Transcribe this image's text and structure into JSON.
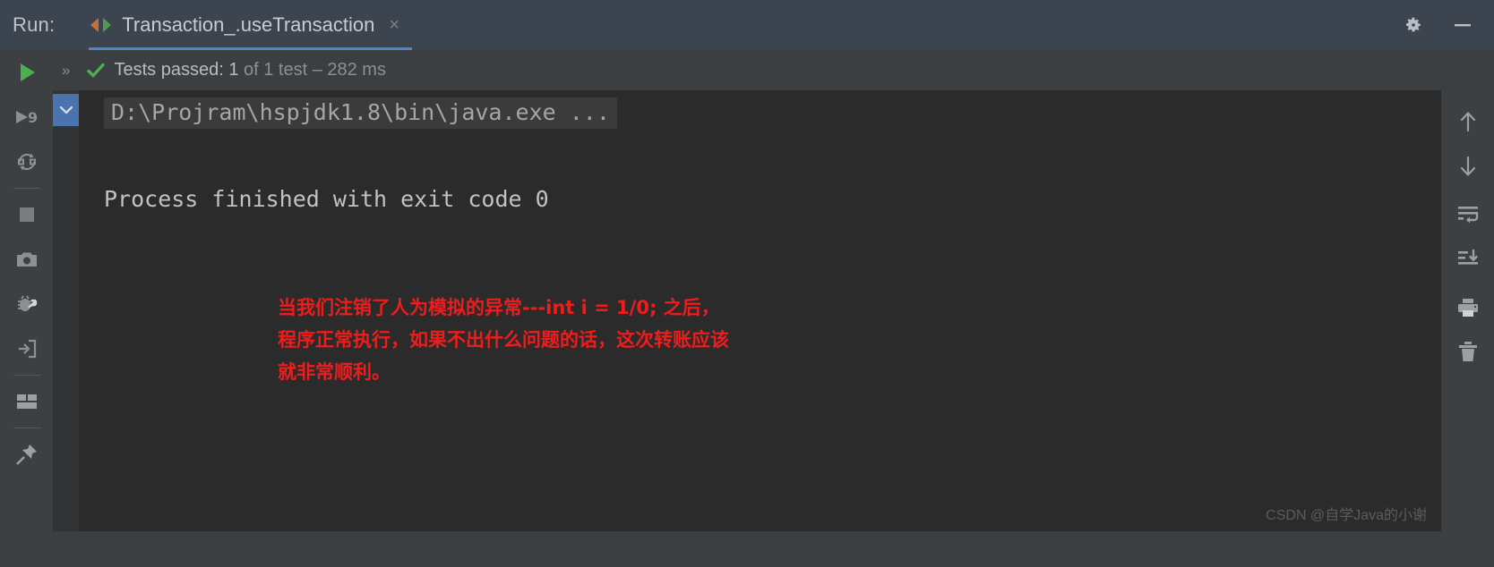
{
  "window": {
    "run_label": "Run:",
    "tab": {
      "title": "Transaction_.useTransaction",
      "icon": "run-test-config-icon",
      "close": "×"
    },
    "controls": {
      "settings_icon": "gear-icon",
      "minimize_icon": "minimize-icon"
    }
  },
  "status": {
    "expand_chevrons": "»",
    "check_icon": "green-check-icon",
    "label": "Tests passed: ",
    "count": "1",
    "suffix": " of 1 test – 282 ms"
  },
  "left_toolbar": [
    {
      "name": "rerun-button",
      "icon": "green-play-icon"
    },
    {
      "name": "rerun-failed-tests-button",
      "icon": "play-with-9-icon"
    },
    {
      "name": "toggle-auto-test-button",
      "icon": "circular-arrows-icon"
    },
    {
      "name": "stop-button",
      "icon": "stop-square-icon"
    },
    {
      "name": "export-test-results-button",
      "icon": "camera-icon"
    },
    {
      "name": "toggle-mute-breakpoints-button",
      "icon": "bug-arrow-icon"
    },
    {
      "name": "import-test-results-button",
      "icon": "import-arrow-box-icon"
    },
    {
      "name": "layout-settings-button",
      "icon": "layout-panes-icon"
    },
    {
      "name": "pin-tab-button",
      "icon": "pin-icon"
    }
  ],
  "right_toolbar": [
    {
      "name": "up-the-stack-trace-button",
      "icon": "arrow-up-icon"
    },
    {
      "name": "down-the-stack-trace-button",
      "icon": "arrow-down-icon"
    },
    {
      "name": "soft-wrap-button",
      "icon": "soft-wrap-icon"
    },
    {
      "name": "scroll-to-end-button",
      "icon": "scroll-to-end-icon"
    },
    {
      "name": "print-button",
      "icon": "printer-icon"
    },
    {
      "name": "clear-all-button",
      "icon": "trash-icon"
    }
  ],
  "console": {
    "fold_icon": "chevron-down-icon",
    "command_line": "D:\\Projram\\hspjdk1.8\\bin\\java.exe ...",
    "exit_line": "Process finished with exit code 0",
    "annotation": "当我们注销了人为模拟的异常---int i = 1/0; 之后，\n程序正常执行，如果不出什么问题的话，这次转账应该\n就非常顺利。",
    "watermark": "CSDN @自学Java的小谢"
  },
  "colors": {
    "titlebar_bg": "#3c4450",
    "tab_underline": "#4a88c7",
    "console_bg": "#2b2b2b",
    "panel_bg": "#3c4042",
    "annotation_red": "#f01c1c",
    "pass_green": "#4f9a52",
    "fold_blue": "#4a73b0"
  }
}
